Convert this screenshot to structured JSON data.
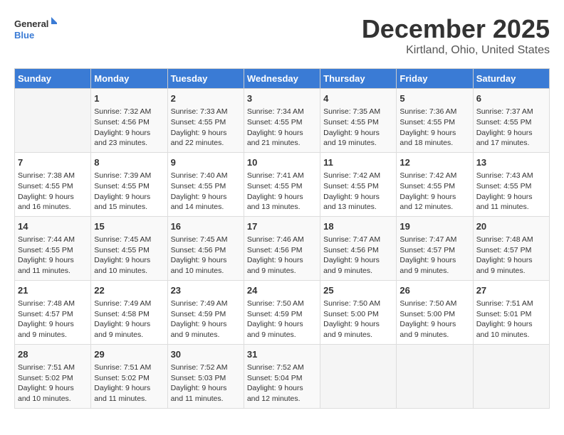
{
  "header": {
    "logo_general": "General",
    "logo_blue": "Blue",
    "title": "December 2025",
    "subtitle": "Kirtland, Ohio, United States"
  },
  "weekdays": [
    "Sunday",
    "Monday",
    "Tuesday",
    "Wednesday",
    "Thursday",
    "Friday",
    "Saturday"
  ],
  "weeks": [
    [
      {
        "day": "",
        "empty": true
      },
      {
        "day": "1",
        "sunrise": "7:32 AM",
        "sunset": "4:56 PM",
        "daylight": "9 hours and 23 minutes."
      },
      {
        "day": "2",
        "sunrise": "7:33 AM",
        "sunset": "4:55 PM",
        "daylight": "9 hours and 22 minutes."
      },
      {
        "day": "3",
        "sunrise": "7:34 AM",
        "sunset": "4:55 PM",
        "daylight": "9 hours and 21 minutes."
      },
      {
        "day": "4",
        "sunrise": "7:35 AM",
        "sunset": "4:55 PM",
        "daylight": "9 hours and 19 minutes."
      },
      {
        "day": "5",
        "sunrise": "7:36 AM",
        "sunset": "4:55 PM",
        "daylight": "9 hours and 18 minutes."
      },
      {
        "day": "6",
        "sunrise": "7:37 AM",
        "sunset": "4:55 PM",
        "daylight": "9 hours and 17 minutes."
      }
    ],
    [
      {
        "day": "7",
        "sunrise": "7:38 AM",
        "sunset": "4:55 PM",
        "daylight": "9 hours and 16 minutes."
      },
      {
        "day": "8",
        "sunrise": "7:39 AM",
        "sunset": "4:55 PM",
        "daylight": "9 hours and 15 minutes."
      },
      {
        "day": "9",
        "sunrise": "7:40 AM",
        "sunset": "4:55 PM",
        "daylight": "9 hours and 14 minutes."
      },
      {
        "day": "10",
        "sunrise": "7:41 AM",
        "sunset": "4:55 PM",
        "daylight": "9 hours and 13 minutes."
      },
      {
        "day": "11",
        "sunrise": "7:42 AM",
        "sunset": "4:55 PM",
        "daylight": "9 hours and 13 minutes."
      },
      {
        "day": "12",
        "sunrise": "7:42 AM",
        "sunset": "4:55 PM",
        "daylight": "9 hours and 12 minutes."
      },
      {
        "day": "13",
        "sunrise": "7:43 AM",
        "sunset": "4:55 PM",
        "daylight": "9 hours and 11 minutes."
      }
    ],
    [
      {
        "day": "14",
        "sunrise": "7:44 AM",
        "sunset": "4:55 PM",
        "daylight": "9 hours and 11 minutes."
      },
      {
        "day": "15",
        "sunrise": "7:45 AM",
        "sunset": "4:55 PM",
        "daylight": "9 hours and 10 minutes."
      },
      {
        "day": "16",
        "sunrise": "7:45 AM",
        "sunset": "4:56 PM",
        "daylight": "9 hours and 10 minutes."
      },
      {
        "day": "17",
        "sunrise": "7:46 AM",
        "sunset": "4:56 PM",
        "daylight": "9 hours and 9 minutes."
      },
      {
        "day": "18",
        "sunrise": "7:47 AM",
        "sunset": "4:56 PM",
        "daylight": "9 hours and 9 minutes."
      },
      {
        "day": "19",
        "sunrise": "7:47 AM",
        "sunset": "4:57 PM",
        "daylight": "9 hours and 9 minutes."
      },
      {
        "day": "20",
        "sunrise": "7:48 AM",
        "sunset": "4:57 PM",
        "daylight": "9 hours and 9 minutes."
      }
    ],
    [
      {
        "day": "21",
        "sunrise": "7:48 AM",
        "sunset": "4:57 PM",
        "daylight": "9 hours and 9 minutes."
      },
      {
        "day": "22",
        "sunrise": "7:49 AM",
        "sunset": "4:58 PM",
        "daylight": "9 hours and 9 minutes."
      },
      {
        "day": "23",
        "sunrise": "7:49 AM",
        "sunset": "4:59 PM",
        "daylight": "9 hours and 9 minutes."
      },
      {
        "day": "24",
        "sunrise": "7:50 AM",
        "sunset": "4:59 PM",
        "daylight": "9 hours and 9 minutes."
      },
      {
        "day": "25",
        "sunrise": "7:50 AM",
        "sunset": "5:00 PM",
        "daylight": "9 hours and 9 minutes."
      },
      {
        "day": "26",
        "sunrise": "7:50 AM",
        "sunset": "5:00 PM",
        "daylight": "9 hours and 9 minutes."
      },
      {
        "day": "27",
        "sunrise": "7:51 AM",
        "sunset": "5:01 PM",
        "daylight": "9 hours and 10 minutes."
      }
    ],
    [
      {
        "day": "28",
        "sunrise": "7:51 AM",
        "sunset": "5:02 PM",
        "daylight": "9 hours and 10 minutes."
      },
      {
        "day": "29",
        "sunrise": "7:51 AM",
        "sunset": "5:02 PM",
        "daylight": "9 hours and 11 minutes."
      },
      {
        "day": "30",
        "sunrise": "7:52 AM",
        "sunset": "5:03 PM",
        "daylight": "9 hours and 11 minutes."
      },
      {
        "day": "31",
        "sunrise": "7:52 AM",
        "sunset": "5:04 PM",
        "daylight": "9 hours and 12 minutes."
      },
      {
        "day": "",
        "empty": true
      },
      {
        "day": "",
        "empty": true
      },
      {
        "day": "",
        "empty": true
      }
    ]
  ],
  "labels": {
    "sunrise": "Sunrise:",
    "sunset": "Sunset:",
    "daylight": "Daylight:"
  }
}
